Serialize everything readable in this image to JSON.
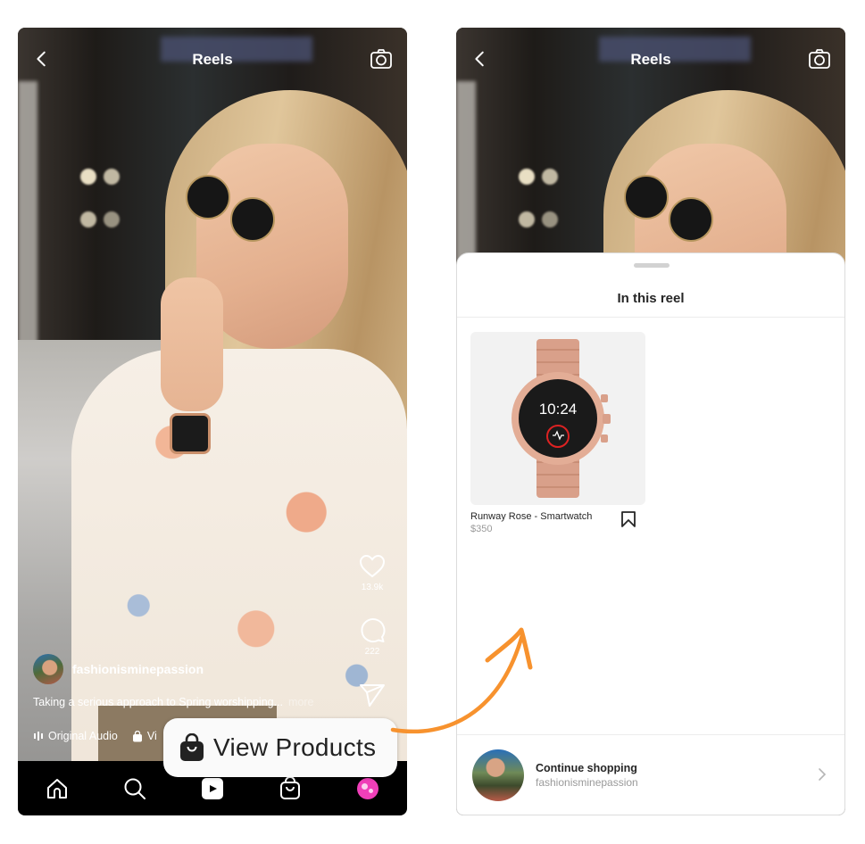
{
  "left_screen": {
    "header": {
      "title": "Reels",
      "back_icon": "chevron-left-icon",
      "camera_icon": "camera-icon"
    },
    "actions": {
      "like": {
        "icon": "heart-icon",
        "count": "13.9k"
      },
      "comment": {
        "icon": "comment-icon",
        "count": "222"
      },
      "share": {
        "icon": "paper-plane-icon"
      }
    },
    "author": {
      "username": "fashionisminepassion"
    },
    "caption": {
      "text": "Taking a serious approach to Spring worshipping...",
      "more": "more"
    },
    "meta": {
      "audio_label": "Original Audio",
      "products_label_truncated": "Vi"
    },
    "callout": {
      "label": "View Products",
      "icon": "shopping-bag-icon"
    },
    "navbar": [
      {
        "name": "home",
        "icon": "home-icon"
      },
      {
        "name": "search",
        "icon": "search-icon"
      },
      {
        "name": "reels",
        "icon": "reels-icon"
      },
      {
        "name": "shop",
        "icon": "shopping-bag-icon"
      },
      {
        "name": "profile",
        "icon": "profile-avatar"
      }
    ]
  },
  "right_screen": {
    "header": {
      "title": "Reels",
      "back_icon": "chevron-left-icon",
      "camera_icon": "camera-icon"
    },
    "sheet": {
      "title": "In this reel",
      "products": [
        {
          "name": "Runway Rose - Smartwatch",
          "price": "$350",
          "watch_time": "10:24"
        }
      ],
      "continue": {
        "title": "Continue shopping",
        "subtitle": "fashionisminepassion"
      }
    }
  },
  "colors": {
    "accent_arrow": "#f7922e",
    "profile_pink": "#f03fb9",
    "rose_gold": "#d99d82"
  }
}
